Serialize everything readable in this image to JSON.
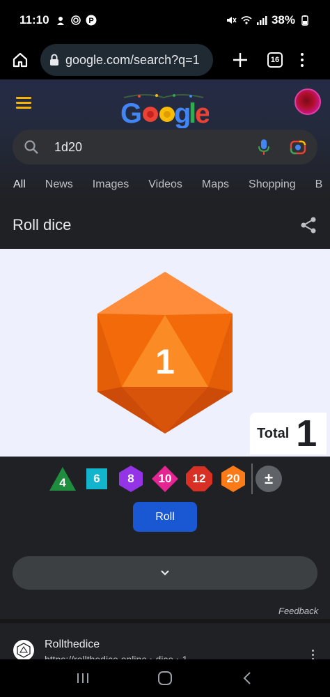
{
  "status_bar": {
    "time": "11:10",
    "battery": "38%"
  },
  "browser": {
    "url": "google.com/search?q=1",
    "tab_count": "16"
  },
  "google": {
    "logo_text": "Google",
    "search_query": "1d20",
    "tabs": [
      "All",
      "News",
      "Images",
      "Videos",
      "Maps",
      "Shopping",
      "B"
    ]
  },
  "dice_widget": {
    "title": "Roll dice",
    "rolled_value": "1",
    "total_label": "Total",
    "total_value": "1",
    "dice_options": [
      {
        "label": "4",
        "color": "#1e8e3e"
      },
      {
        "label": "6",
        "color": "#12b5cb"
      },
      {
        "label": "8",
        "color": "#9334e6"
      },
      {
        "label": "10",
        "color": "#e52592"
      },
      {
        "label": "12",
        "color": "#d93025"
      },
      {
        "label": "20",
        "color": "#fa7b17"
      }
    ],
    "modifier_label": "±",
    "roll_button": "Roll",
    "feedback": "Feedback"
  },
  "result": {
    "site_name": "Rollthedice",
    "url": "https://rollthedice.online › dice › 1"
  },
  "colors": {
    "die_orange": "#fa7b17",
    "roll_button": "#1a57d3",
    "panel_bg": "#eef0fe"
  }
}
